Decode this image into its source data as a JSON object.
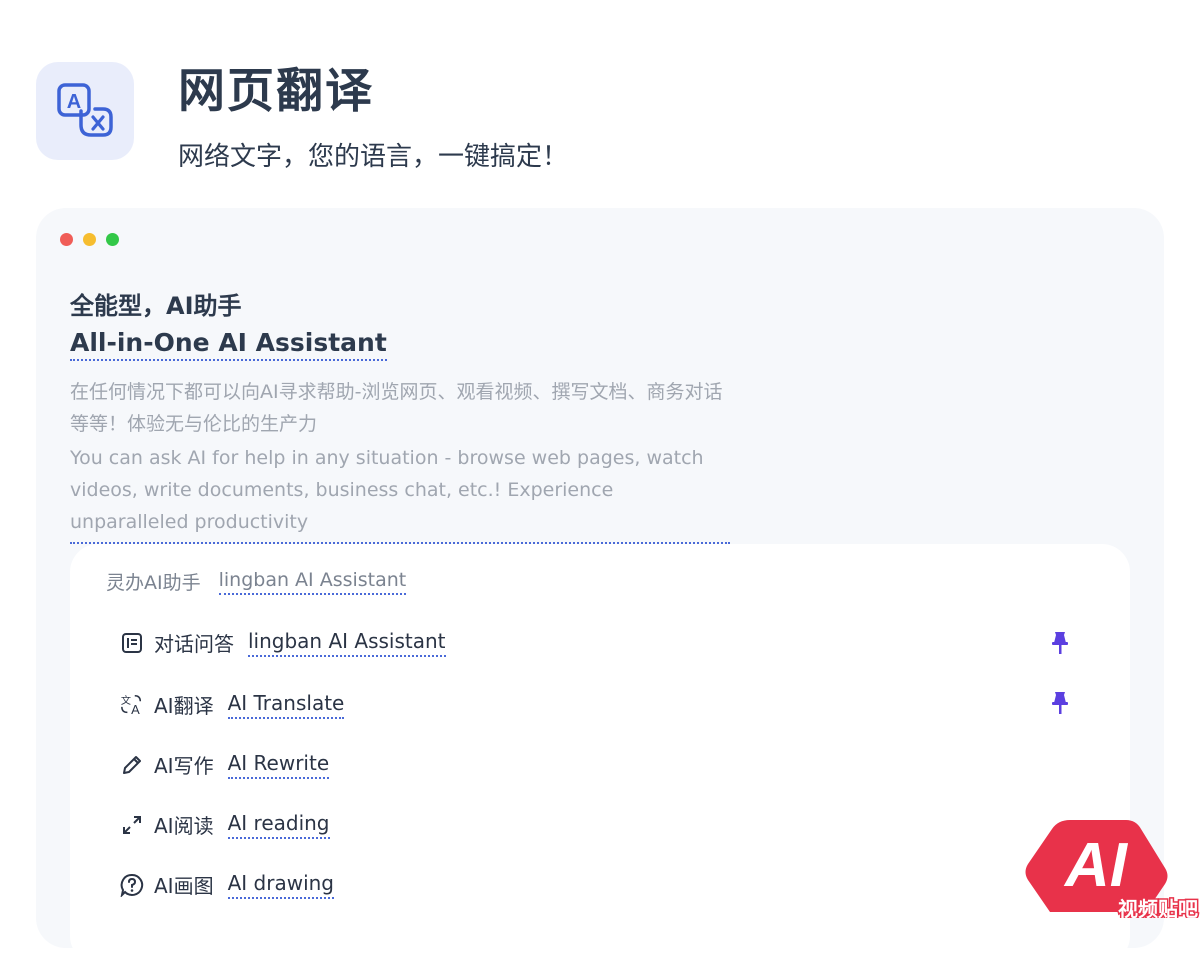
{
  "header": {
    "icon": "translate-icon",
    "title": "网页翻译",
    "subtitle": "网络文字，您的语言，一键搞定！"
  },
  "window": {
    "controls": [
      "close",
      "minimize",
      "maximize"
    ],
    "feature_title_zh": "全能型，AI助手",
    "feature_title_en": "All-in-One AI Assistant",
    "description_zh": "在任何情况下都可以向AI寻求帮助-浏览网页、观看视频、撰写文档、商务对话等等！体验无与伦比的生产力",
    "description_en": "You can ask AI for help in any situation - browse web pages, watch videos, write documents, business chat, etc.! Experience unparalleled productivity"
  },
  "panel": {
    "heading_zh": "灵办AI助手",
    "heading_en": "lingban AI Assistant",
    "items": [
      {
        "icon": "chat-list-icon",
        "label_zh": "对话问答",
        "label_en": "lingban AI Assistant",
        "pinned": true
      },
      {
        "icon": "translate-icon",
        "label_zh": "AI翻译",
        "label_en": "AI Translate",
        "pinned": true
      },
      {
        "icon": "pencil-icon",
        "label_zh": "AI写作",
        "label_en": "AI Rewrite",
        "pinned": false
      },
      {
        "icon": "expand-icon",
        "label_zh": "AI阅读",
        "label_en": "AI reading",
        "pinned": false
      },
      {
        "icon": "question-bubble-icon",
        "label_zh": "AI画图",
        "label_en": "AI drawing",
        "pinned": false
      }
    ]
  },
  "watermark": {
    "logo_text": "AI",
    "caption": "视频贴吧"
  },
  "colors": {
    "accent": "#4a6ad8",
    "pin": "#5b3fe0",
    "title": "#2d3a4d",
    "muted": "#a0a6b0"
  }
}
